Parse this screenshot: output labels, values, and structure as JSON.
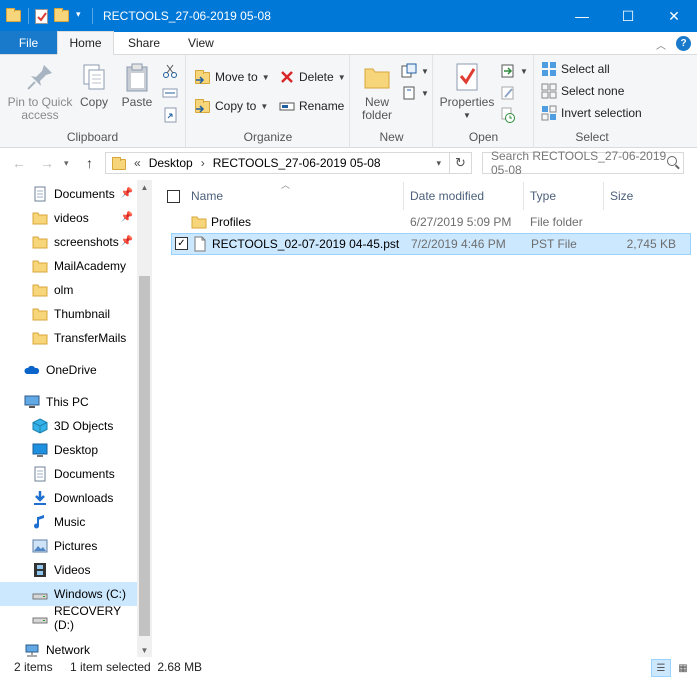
{
  "window": {
    "title": "RECTOOLS_27-06-2019 05-08",
    "minimize": "—",
    "maximize": "☐",
    "close": "✕",
    "accent": "#0078d7"
  },
  "ribbon_tabs": [
    "File",
    "Home",
    "Share",
    "View"
  ],
  "ribbon": {
    "clipboard": {
      "label": "Clipboard",
      "pin_line1": "Pin to Quick",
      "pin_line2": "access",
      "copy": "Copy",
      "paste": "Paste"
    },
    "organize": {
      "label": "Organize",
      "move_to": "Move to",
      "copy_to": "Copy to",
      "delete": "Delete",
      "rename": "Rename"
    },
    "new": {
      "label": "New",
      "new_folder_line1": "New",
      "new_folder_line2": "folder"
    },
    "open": {
      "label": "Open",
      "properties": "Properties"
    },
    "select": {
      "label": "Select",
      "select_all": "Select all",
      "select_none": "Select none",
      "invert": "Invert selection"
    }
  },
  "address": {
    "prefix": "«",
    "crumb1": "Desktop",
    "sep": "›",
    "crumb2": "RECTOOLS_27-06-2019 05-08",
    "search_placeholder": "Search RECTOOLS_27-06-2019 05-08"
  },
  "nav": {
    "quick_access": [
      {
        "label": "Documents",
        "icon": "document-icon",
        "pinned": true
      },
      {
        "label": "videos",
        "icon": "folder-icon",
        "pinned": true
      },
      {
        "label": "screenshots",
        "icon": "folder-icon",
        "pinned": true
      },
      {
        "label": "MailAcademy",
        "icon": "folder-icon",
        "pinned": false
      },
      {
        "label": "olm",
        "icon": "folder-icon",
        "pinned": false
      },
      {
        "label": "Thumbnail",
        "icon": "folder-icon",
        "pinned": false
      },
      {
        "label": "TransferMails",
        "icon": "folder-icon",
        "pinned": false
      }
    ],
    "onedrive": "OneDrive",
    "this_pc": "This PC",
    "pc_items": [
      {
        "label": "3D Objects",
        "icon": "cube-icon"
      },
      {
        "label": "Desktop",
        "icon": "desktop-icon"
      },
      {
        "label": "Documents",
        "icon": "document-icon"
      },
      {
        "label": "Downloads",
        "icon": "download-icon"
      },
      {
        "label": "Music",
        "icon": "music-icon"
      },
      {
        "label": "Pictures",
        "icon": "picture-icon"
      },
      {
        "label": "Videos",
        "icon": "film-icon"
      },
      {
        "label": "Windows (C:)",
        "icon": "drive-icon"
      },
      {
        "label": "RECOVERY (D:)",
        "icon": "drive-icon"
      }
    ],
    "network": "Network"
  },
  "columns": {
    "name": "Name",
    "date": "Date modified",
    "type": "Type",
    "size": "Size"
  },
  "files": [
    {
      "name": "Profiles",
      "date": "6/27/2019 5:09 PM",
      "type": "File folder",
      "size": "",
      "selected": false
    },
    {
      "name": "RECTOOLS_02-07-2019 04-45.pst",
      "date": "7/2/2019 4:46 PM",
      "type": "PST File",
      "size": "2,745 KB",
      "selected": true
    }
  ],
  "status": {
    "items": "2 items",
    "selected": "1 item selected  2.68 MB"
  }
}
